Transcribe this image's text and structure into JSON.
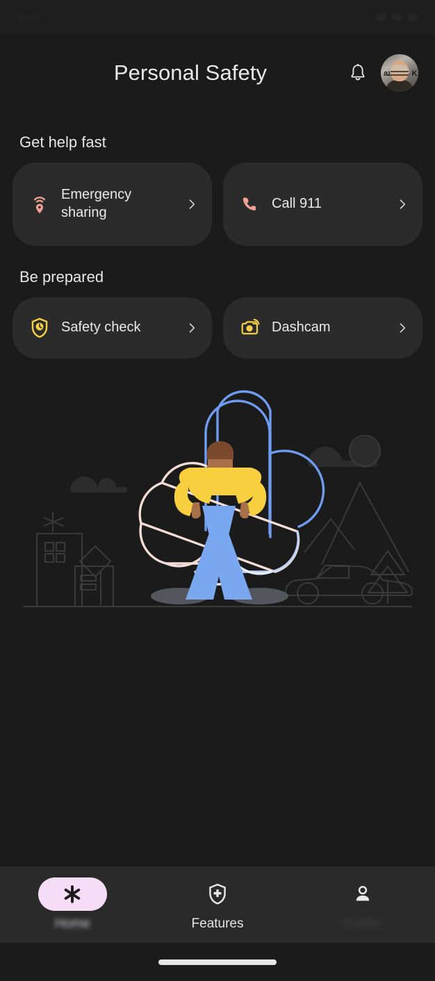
{
  "statusbar": {
    "left_text": "5:14",
    "right_icons": [
      "signal-icon",
      "wifi-icon",
      "battery-icon"
    ]
  },
  "header": {
    "title": "Personal Safety",
    "bell_icon": "bell-icon",
    "avatar_label": "az",
    "avatar_label_right": "K"
  },
  "sections": [
    {
      "title": "Get help fast",
      "cards": [
        {
          "label": "Emergency sharing",
          "icon": "location-broadcast-icon",
          "color": "#f0a193",
          "chevron": "chevron-right-icon"
        },
        {
          "label": "Call 911",
          "icon": "phone-icon",
          "color": "#f0a193",
          "chevron": "chevron-right-icon"
        }
      ]
    },
    {
      "title": "Be prepared",
      "cards": [
        {
          "label": "Safety check",
          "icon": "shield-clock-icon",
          "color": "#f5cf45",
          "chevron": "chevron-right-icon"
        },
        {
          "label": "Dashcam",
          "icon": "dashcam-icon",
          "color": "#f5cf45",
          "chevron": "chevron-right-icon"
        }
      ]
    }
  ],
  "illustration": {
    "name": "person-safety-illustration",
    "colors": {
      "top": "#f7cf3f",
      "pants": "#7aa8f0",
      "skin": "#a9714a",
      "hair": "#7b4a2d",
      "shadow": "#53565c",
      "flower_pink": "#f3ddd6",
      "flower_blue": "#6f9cf0",
      "scenery": "#2e2e2e"
    }
  },
  "bottomnav": {
    "items": [
      {
        "label": "Home",
        "icon": "asterisk-icon",
        "active": true
      },
      {
        "label": "Features",
        "icon": "shield-cross-icon",
        "active": false
      },
      {
        "label": "Profile",
        "icon": "person-icon",
        "active": false
      }
    ],
    "active_pill_color": "#f5ddf7"
  },
  "gesture_bar": {
    "name": "gesture-handle"
  }
}
